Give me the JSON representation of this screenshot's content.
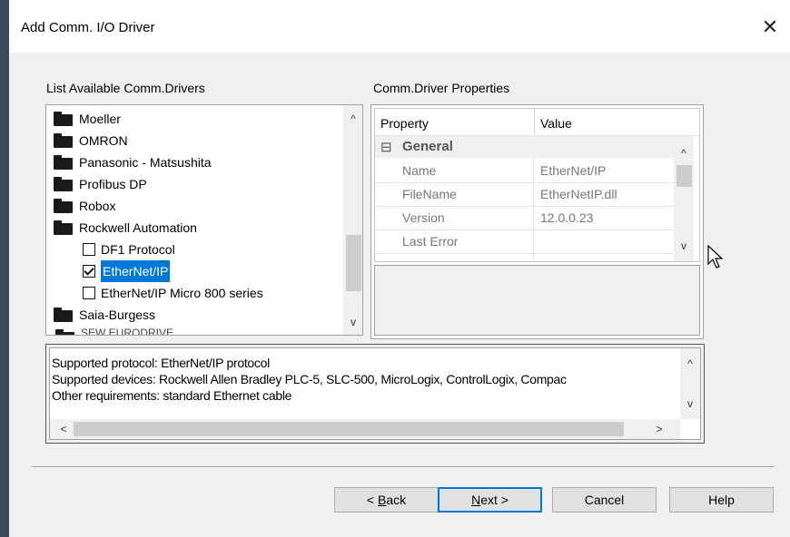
{
  "window": {
    "title": "Add Comm. I/O Driver",
    "close_glyph": "✕"
  },
  "drivers": {
    "label": "List Available Comm.Drivers",
    "items": [
      {
        "label": "Moeller",
        "type": "folder"
      },
      {
        "label": "OMRON",
        "type": "folder"
      },
      {
        "label": "Panasonic - Matsushita",
        "type": "folder"
      },
      {
        "label": "Profibus DP",
        "type": "folder"
      },
      {
        "label": "Robox",
        "type": "folder"
      },
      {
        "label": "Rockwell Automation",
        "type": "folder"
      },
      {
        "label": "DF1 Protocol",
        "type": "checkbox",
        "checked": false
      },
      {
        "label": "EtherNet/IP",
        "type": "checkbox",
        "checked": true,
        "selected": true
      },
      {
        "label": "EtherNet/IP Micro 800 series",
        "type": "checkbox",
        "checked": false
      },
      {
        "label": "Saia-Burgess",
        "type": "folder"
      }
    ],
    "partial_item": "SEW EURODRIVE"
  },
  "properties": {
    "label": "Comm.Driver Properties",
    "header_property": "Property",
    "header_value": "Value",
    "group_toggle": "⊟",
    "group": "General",
    "rows": [
      {
        "name": "Name",
        "value": "EtherNet/IP"
      },
      {
        "name": "FileName",
        "value": "EtherNetIP.dll"
      },
      {
        "name": "Version",
        "value": "12.0.0.23"
      },
      {
        "name": "Last Error",
        "value": ""
      }
    ]
  },
  "description": {
    "lines": [
      "Supported protocol: EtherNet/IP protocol",
      "Supported devices: Rockwell Allen Bradley PLC-5, SLC-500, MicroLogix, ControlLogix, Compac",
      "Other requirements: standard Ethernet cable"
    ]
  },
  "scroll_glyphs": {
    "up": "^",
    "down": "v",
    "left": "<",
    "right": ">"
  },
  "buttons": {
    "back_mnemonic": "B",
    "back_rest": "ack",
    "back_prefix": "< ",
    "next_mnemonic": "N",
    "next_rest": "ext >",
    "cancel": "Cancel",
    "help": "Help"
  }
}
